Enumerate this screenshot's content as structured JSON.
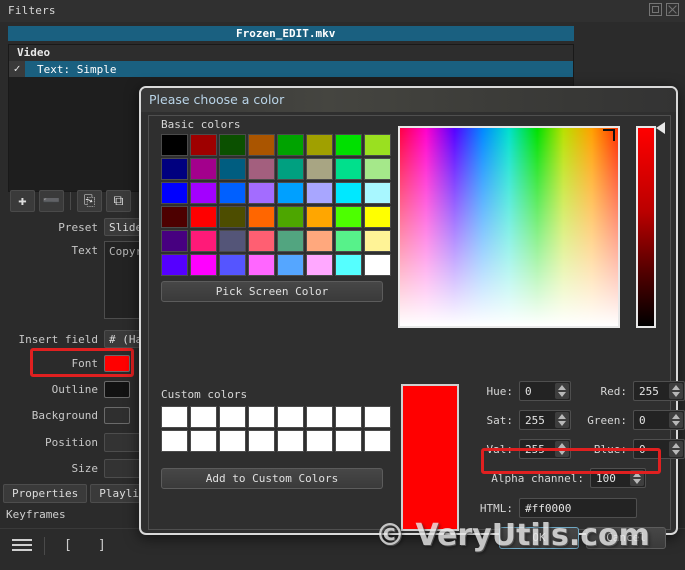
{
  "app": {
    "title": "Filters",
    "window_buttons": [
      {
        "name": "float-window-button",
        "icon": "float-icon"
      },
      {
        "name": "close-window-button",
        "icon": "close-icon"
      }
    ],
    "file_name": "Frozen_EDIT.mkv",
    "filter_list": {
      "group": "Video",
      "item_label": "Text: Simple",
      "item_checked": "✓"
    },
    "toolbar": {
      "add": "✚",
      "remove": "➖",
      "copy": "⎘",
      "paste": "⧉"
    },
    "fields": {
      "preset_label": "Preset",
      "preset_value": "Slide",
      "text_label": "Text",
      "text_value": "Copyri",
      "insert_field_label": "Insert field",
      "insert_field_value": "# (Has",
      "font_label": "Font",
      "font_color": "#ff0000",
      "outline_label": "Outline",
      "outline_color": "#121212",
      "background_label": "Background",
      "background_color": "transparent",
      "position_label": "Position",
      "size_label": "Size"
    },
    "bottom_tabs": [
      "Properties",
      "Playlis"
    ],
    "keyframes_label": "Keyframes",
    "bottom_bar": {
      "menu_icon": "hamburger-icon",
      "mark_in": "[",
      "mark_out": "]"
    }
  },
  "dialog": {
    "title": "Please choose a color",
    "basic_colors_label": "Basic colors",
    "basic_colors": [
      "#000000",
      "#9e0000",
      "#0b5000",
      "#aa5500",
      "#00a300",
      "#a0a000",
      "#00e000",
      "#9ae020",
      "#00007f",
      "#a3008c",
      "#005d80",
      "#a35f7e",
      "#00a080",
      "#a8a583",
      "#00e08c",
      "#a5e88a",
      "#0000ff",
      "#a300ff",
      "#0060ff",
      "#a36cff",
      "#00a0ff",
      "#a8a6ff",
      "#00e8ff",
      "#a8f7ff",
      "#4d0000",
      "#ff0000",
      "#4d4d00",
      "#ff6600",
      "#4da600",
      "#ffa600",
      "#4dff00",
      "#ffff00",
      "#470080",
      "#ff1a78",
      "#545578",
      "#ff5f72",
      "#52a580",
      "#ffa87d",
      "#57f28a",
      "#fff396",
      "#5500ff",
      "#ff00ff",
      "#5555ff",
      "#ff66ff",
      "#55a6ff",
      "#ffa8ff",
      "#55ffff",
      "#ffffff"
    ],
    "pick_screen_color": "Pick Screen Color",
    "custom_colors_label": "Custom colors",
    "custom_colors": [
      "#ffffff",
      "#ffffff",
      "#ffffff",
      "#ffffff",
      "#ffffff",
      "#ffffff",
      "#ffffff",
      "#ffffff",
      "#ffffff",
      "#ffffff",
      "#ffffff",
      "#ffffff",
      "#ffffff",
      "#ffffff",
      "#ffffff",
      "#ffffff"
    ],
    "add_to_custom_colors": "Add to Custom Colors",
    "preview_color": "#ff0000",
    "fields": {
      "hue_label": "Hue:",
      "hue_value": "0",
      "sat_label": "Sat:",
      "sat_value": "255",
      "val_label": "Val:",
      "val_value": "255",
      "red_label": "Red:",
      "red_value": "255",
      "green_label": "Green:",
      "green_value": "0",
      "blue_label": "Blue:",
      "blue_value": "0",
      "alpha_label": "Alpha channel:",
      "alpha_value": "100",
      "html_label": "HTML:",
      "html_value": "#ff0000"
    },
    "buttons": {
      "ok": "OK",
      "cancel": "Cancel"
    }
  },
  "watermark": "© VeryUtils.com",
  "highlight_color": "#e02020"
}
